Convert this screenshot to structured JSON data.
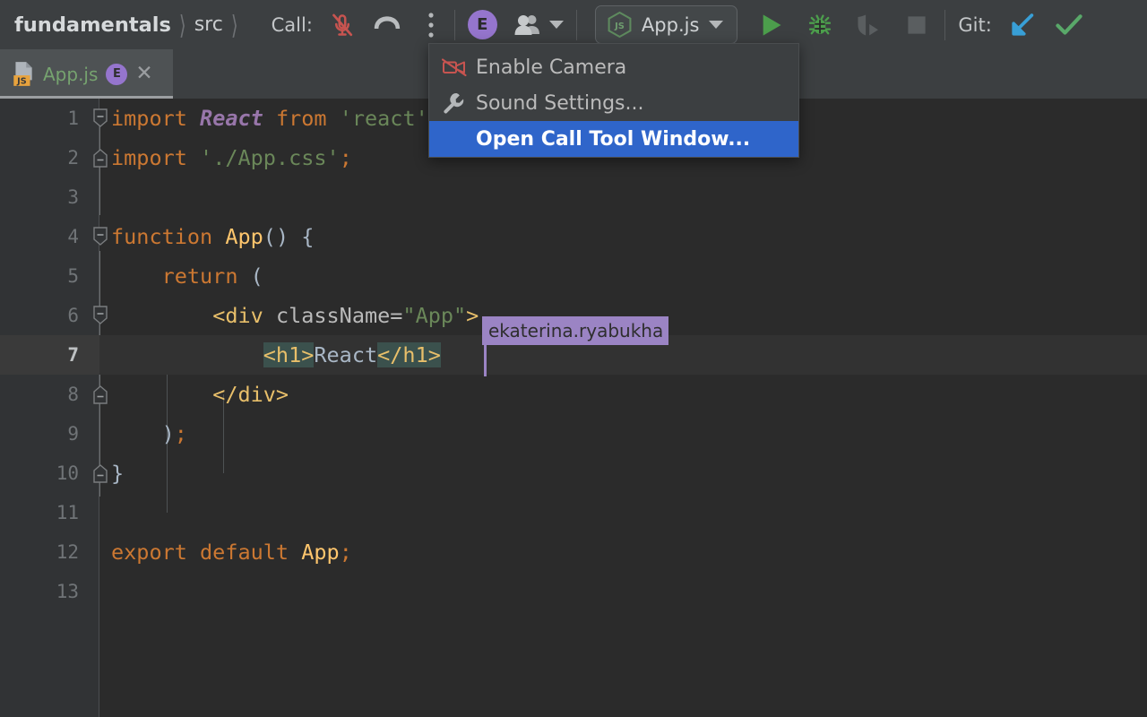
{
  "toolbar": {
    "breadcrumbs": [
      {
        "label": "fundamentals",
        "type": "project"
      },
      {
        "label": "src",
        "type": "folder"
      }
    ],
    "call_label": "Call:",
    "mic_icon": "microphone-muted-icon",
    "hangup_icon": "hangup-phone-icon",
    "more_icon": "more-vertical-icon",
    "avatar_initial": "E",
    "participants_icon": "participants-icon",
    "run_config": {
      "name": "App.js",
      "icon": "nodejs-js-icon"
    },
    "run_icon": "run-icon",
    "debug_icon": "debug-bug-icon",
    "coverage_icon": "run-with-coverage-icon",
    "stop_icon": "stop-icon",
    "git_label": "Git:",
    "git_update_icon": "git-update-arrow-icon",
    "git_commit_icon": "git-commit-check-icon",
    "colors": {
      "accent_purple": "#9575CD",
      "run_green": "#4C9E4C",
      "mic_red": "#C75450",
      "git_blue": "#389FD6",
      "git_green": "#59A869"
    }
  },
  "tab": {
    "filename": "App.js",
    "file_icon": "javascript-file-icon",
    "badge_label": "JS",
    "collaborator_initial": "E",
    "close_icon": "close-icon"
  },
  "menu": {
    "items": [
      {
        "label": "Enable Camera",
        "icon": "camera-off-icon",
        "selected": false
      },
      {
        "label": "Sound Settings...",
        "icon": "wrench-icon",
        "selected": false
      },
      {
        "label": "Open Call Tool Window...",
        "icon": "",
        "selected": true
      }
    ],
    "selection_color": "#2F65CA"
  },
  "editor": {
    "collab_caret": {
      "name": "ekaterina.ryabukha",
      "color": "#9B84C4"
    },
    "current_line": 7,
    "line_numbers": [
      "1",
      "2",
      "3",
      "4",
      "5",
      "6",
      "7",
      "8",
      "9",
      "10",
      "11",
      "12",
      "13"
    ],
    "lines": [
      {
        "n": "1",
        "text": "import React from 'react';"
      },
      {
        "n": "2",
        "text": "import './App.css';"
      },
      {
        "n": "3",
        "text": ""
      },
      {
        "n": "4",
        "text": "function App() {"
      },
      {
        "n": "5",
        "text": "    return ("
      },
      {
        "n": "6",
        "text": "        <div className=\"App\">"
      },
      {
        "n": "7",
        "text": "            <h1>React</h1>"
      },
      {
        "n": "8",
        "text": "        </div>"
      },
      {
        "n": "9",
        "text": "    );"
      },
      {
        "n": "10",
        "text": "}"
      },
      {
        "n": "11",
        "text": ""
      },
      {
        "n": "12",
        "text": "export default App;"
      },
      {
        "n": "13",
        "text": ""
      }
    ]
  }
}
